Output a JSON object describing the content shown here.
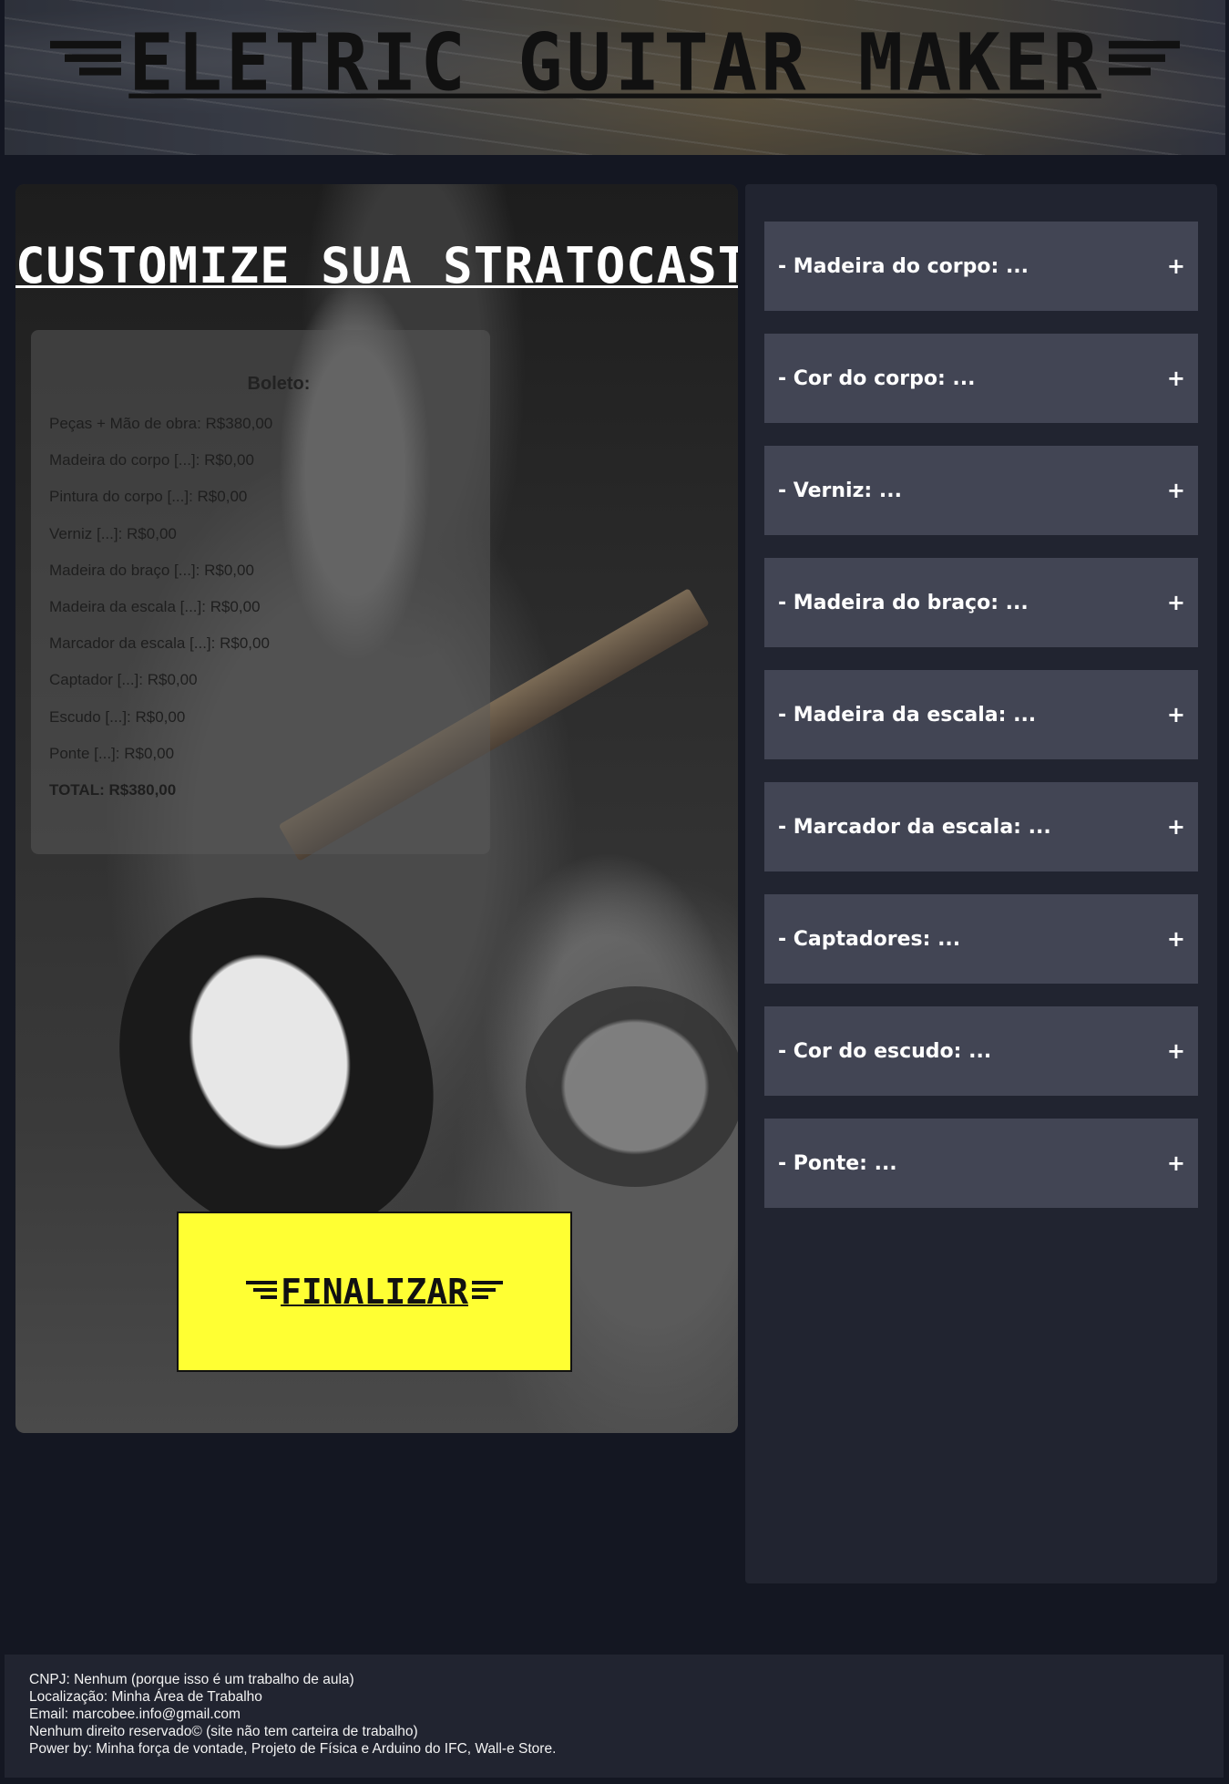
{
  "header": {
    "title": "ELETRIC GUITAR MAKER"
  },
  "main": {
    "title": "CUSTOMIZE SUA STRATOCASTER",
    "receipt": {
      "title": "Boleto:",
      "lines": [
        "Peças + Mão de obra: R$380,00",
        "Madeira do corpo [...]: R$0,00",
        "Pintura do corpo [...]: R$0,00",
        "Verniz [...]: R$0,00",
        "Madeira do braço [...]: R$0,00",
        "Madeira da escala [...]: R$0,00",
        "Marcador da escala [...]: R$0,00",
        "Captador [...]: R$0,00",
        "Escudo [...]: R$0,00",
        "Ponte [...]: R$0,00"
      ],
      "total": "TOTAL: R$380,00"
    },
    "finalize_label": "FINALIZAR"
  },
  "options": {
    "expand_symbol": "+",
    "items": [
      "- Madeira do corpo: ...",
      "- Cor do corpo: ...",
      "- Verniz: ...",
      "- Madeira do braço: ...",
      "- Madeira da escala: ...",
      "- Marcador da escala: ...",
      "- Captadores: ...",
      "- Cor do escudo: ...",
      "- Ponte: ..."
    ]
  },
  "footer": {
    "lines": [
      "CNPJ: Nenhum (porque isso é um trabalho de aula)",
      "Localização: Minha Área de Trabalho",
      "Email: marcobee.info@gmail.com",
      "Nenhum direito reservado© (site não tem carteira de trabalho)",
      "Power by: Minha força de vontade, Projeto de Física e Arduino do IFC, Wall-e Store."
    ]
  },
  "colors": {
    "page_background": "#141722",
    "panel_background": "#212430",
    "option_background": "#424554",
    "finalize_button": "#ffff33"
  }
}
